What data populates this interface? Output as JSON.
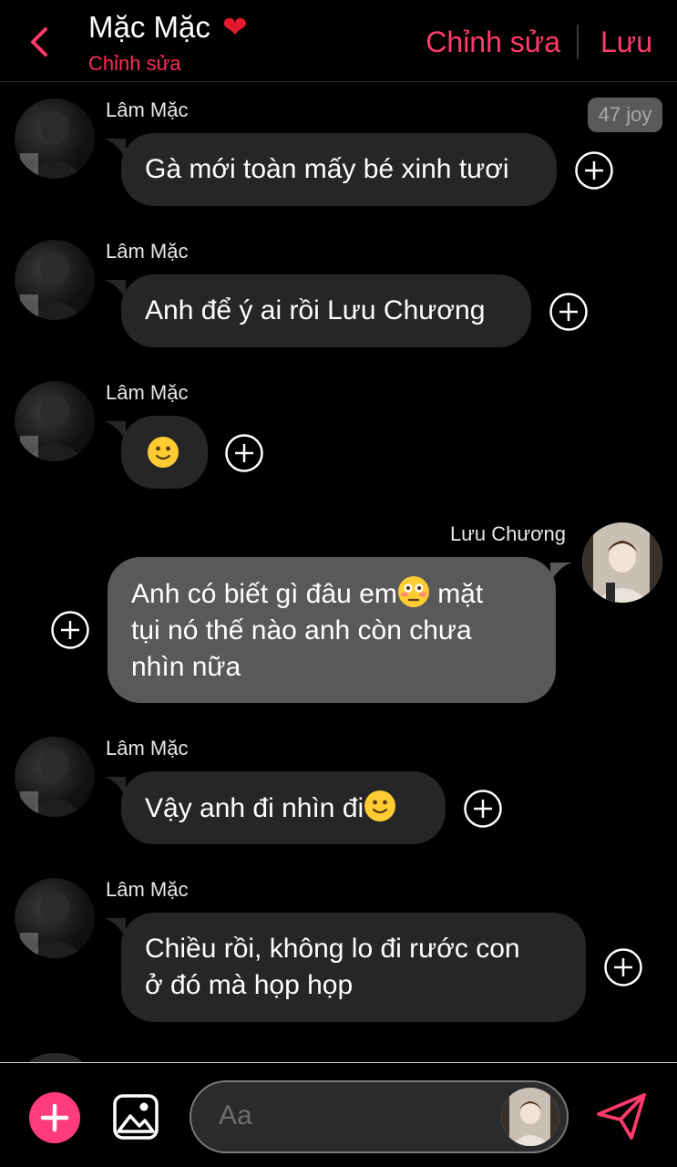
{
  "header": {
    "title": "Mặc Mặc",
    "title_heart": "❤",
    "subtitle": "Chỉnh sửa",
    "edit_label": "Chỉnh sửa",
    "save_label": "Lưu"
  },
  "joy_badge": "47 joy",
  "messages": [
    {
      "sender": "Lâm Mặc",
      "text": "Gà mới toàn mấy bé xinh tươi"
    },
    {
      "sender": "Lâm Mặc",
      "text": "Anh để ý ai rồi Lưu Chương"
    },
    {
      "sender": "Lâm Mặc",
      "emoji": "slightly-smiling-face"
    },
    {
      "sender": "Lưu Chương",
      "line1_a": "Anh có biết gì đâu em",
      "emoji": "flushed-face",
      "line1_b": " mặt",
      "line2": "tụi nó thế nào anh còn chưa",
      "line3": "nhìn nữa"
    },
    {
      "sender": "Lâm Mặc",
      "text": "Vậy anh đi nhìn đi",
      "emoji": "slightly-smiling-face"
    },
    {
      "sender": "Lâm Mặc",
      "line1": "Chiều rồi, không lo đi rước con",
      "line2": "ở đó mà họp họp"
    }
  ],
  "composer": {
    "placeholder": "Aa"
  },
  "colors": {
    "accent": "#ff3b6b",
    "incoming_bubble": "#262626",
    "outgoing_bubble": "#595959",
    "add_button": "#ff3b7f"
  }
}
